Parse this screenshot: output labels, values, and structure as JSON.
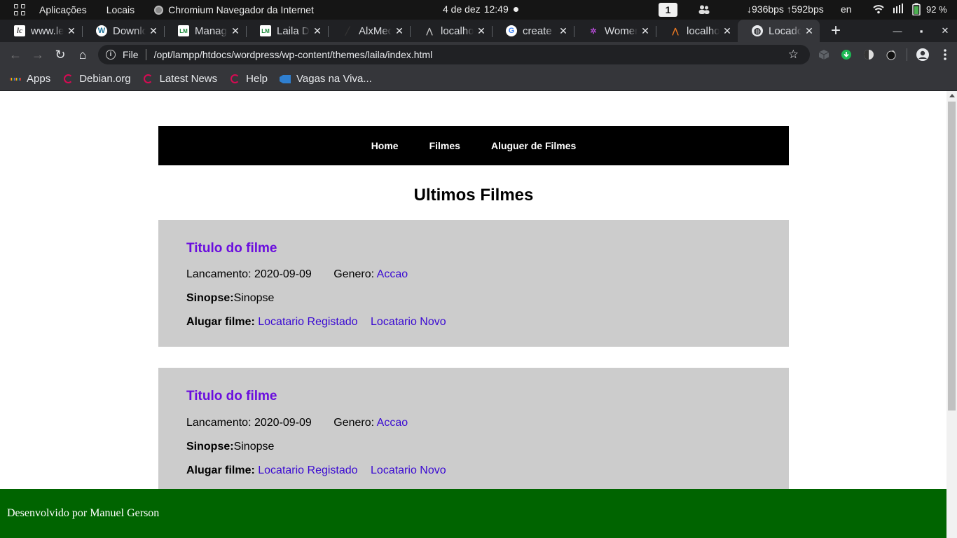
{
  "panel": {
    "activities_icon": "grid-icon",
    "menus": [
      "Aplicações",
      "Locais"
    ],
    "app_name": "Chromium Navegador da Internet",
    "date": "4 de dez",
    "time": "12:49",
    "workspace": "1",
    "network_speed": "↓936bps ↑592bps",
    "language": "en",
    "battery": "92 %"
  },
  "tabs": [
    {
      "title": "www.le",
      "icon": "lc-icon",
      "active": false
    },
    {
      "title": "Downlo",
      "icon": "wordpress-icon",
      "active": false
    },
    {
      "title": "Manage",
      "icon": "site-icon",
      "active": false
    },
    {
      "title": "Laila De",
      "icon": "site-icon",
      "active": false
    },
    {
      "title": "AlxMed",
      "icon": "alx-icon",
      "active": false
    },
    {
      "title": "localhos",
      "icon": "xampp-icon",
      "active": false
    },
    {
      "title": "create s",
      "icon": "google-icon",
      "active": false
    },
    {
      "title": "Women",
      "icon": "women-icon",
      "active": false
    },
    {
      "title": "localhos",
      "icon": "xampp-icon",
      "active": false
    },
    {
      "title": "Locador",
      "icon": "globe-icon",
      "active": true
    }
  ],
  "toolbar": {
    "scheme_label": "File",
    "url": "/opt/lampp/htdocs/wordpress/wp-content/themes/laila/index.html"
  },
  "bookmarks": [
    {
      "label": "Apps",
      "icon": "apps-grid-icon"
    },
    {
      "label": "Debian.org",
      "icon": "debian-icon"
    },
    {
      "label": "Latest News",
      "icon": "debian-icon"
    },
    {
      "label": "Help",
      "icon": "debian-icon"
    },
    {
      "label": "Vagas na Viva...",
      "icon": "folder-tag-icon"
    }
  ],
  "site": {
    "nav": [
      "Home",
      "Filmes",
      "Aluguer de Filmes"
    ],
    "heading": "Ultimos Filmes",
    "movies": [
      {
        "title": "Titulo do filme",
        "release_label": "Lancamento:",
        "release_date": "2020-09-09",
        "genre_label": "Genero:",
        "genre": "Accao",
        "synopsis_label": "Sinopse:",
        "synopsis": "Sinopse",
        "rent_label": "Alugar filme:",
        "rent_registered": "Locatario Registado",
        "rent_new": "Locatario Novo"
      },
      {
        "title": "Titulo do filme",
        "release_label": "Lancamento:",
        "release_date": "2020-09-09",
        "genre_label": "Genero:",
        "genre": "Accao",
        "synopsis_label": "Sinopse:",
        "synopsis": "Sinopse",
        "rent_label": "Alugar filme:",
        "rent_registered": "Locatario Registado",
        "rent_new": "Locatario Novo"
      }
    ],
    "footer": "Desenvolvido por Manuel Gerson"
  },
  "colors": {
    "nav_bg": "#000000",
    "card_bg": "#cccccc",
    "title_link": "#6a0dde",
    "link": "#3a0ad2",
    "footer_bg": "#006400"
  }
}
